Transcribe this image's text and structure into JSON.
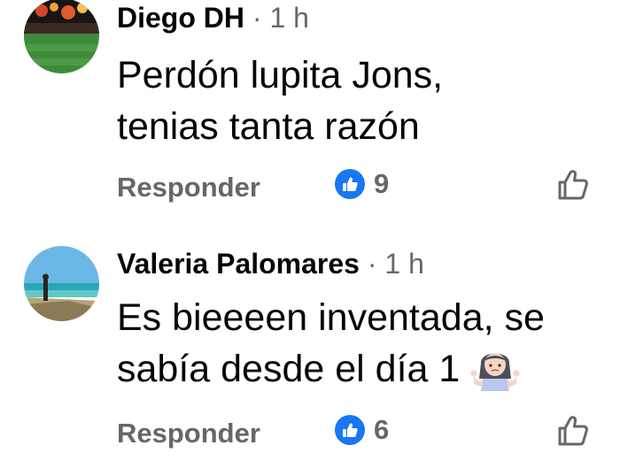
{
  "comments": [
    {
      "author": "Diego DH",
      "separator": "·",
      "time": "1 h",
      "text_lines": [
        "Perdón lupita Jons,",
        "tenias tanta razón"
      ],
      "reply_label": "Responder",
      "reaction_count": "9",
      "avatar_icon": "stadium-photo-avatar"
    },
    {
      "author": "Valeria Palomares",
      "separator": "·",
      "time": "1 h",
      "text_lines": [
        "Es bieeeen inventada, se",
        "sabía desde el día 1"
      ],
      "emoji": "woman-shrugging-emoji",
      "reply_label": "Responder",
      "reaction_count": "6",
      "avatar_icon": "beach-photo-avatar"
    }
  ],
  "colors": {
    "text": "#050505",
    "secondary": "#65676b",
    "like_blue": "#1877f2"
  }
}
